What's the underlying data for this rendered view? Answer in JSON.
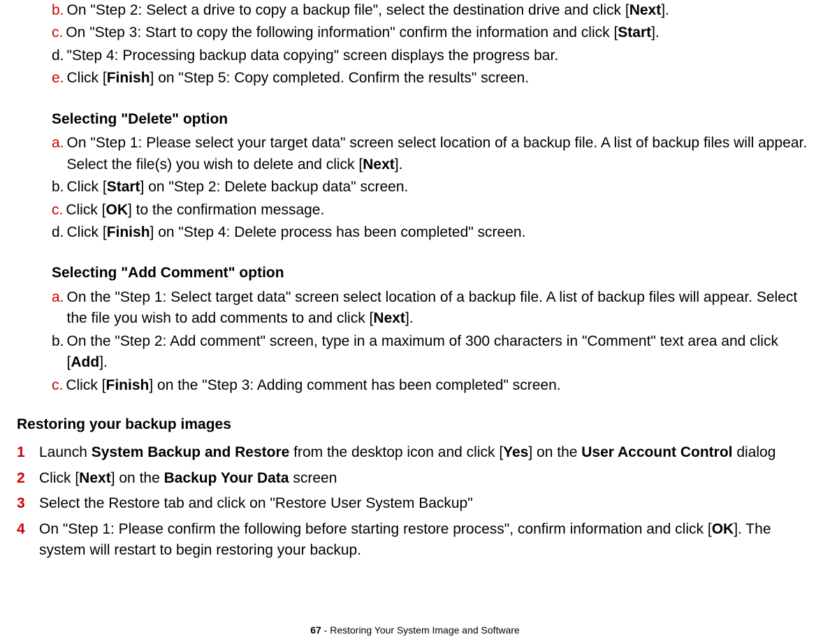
{
  "copy_section": {
    "b": {
      "part1": "On \"Step 2: Select a drive to copy a backup file\", select the destination drive and click  [",
      "btn": "Next",
      "part2": "]."
    },
    "c": {
      "part1": "On \"Step 3: Start to copy the following information\" confirm the information and click  [",
      "btn": "Start",
      "part2": "]."
    },
    "d": "\"Step 4: Processing backup data copying\" screen displays the progress bar.",
    "e": {
      "part1": "Click [",
      "btn": "Finish",
      "part2": "] on \"Step 5: Copy completed. Confirm the results\" screen."
    }
  },
  "delete_section": {
    "heading": "Selecting \"Delete\" option",
    "a": {
      "part1": "On \"Step 1: Please select your target data\" screen select location of a backup file.  A list of backup files will appear. Select the file(s) you wish to delete and click [",
      "btn": "Next",
      "part2": "]."
    },
    "b": {
      "part1": "Click [",
      "btn": "Start",
      "part2": "] on \"Step 2: Delete backup data\" screen."
    },
    "c": {
      "part1": "Click [",
      "btn": "OK",
      "part2": "] to the confirmation message."
    },
    "d": {
      "part1": "Click [",
      "btn": "Finish",
      "part2": "] on \"Step 4: Delete process has been completed\" screen."
    }
  },
  "addcomment_section": {
    "heading": "Selecting \"Add Comment\" option",
    "a": {
      "part1": "On the \"Step 1: Select target data\" screen select location of a backup file. A list of backup files will appear. Select the file you wish to add comments to and click [",
      "btn": "Next",
      "part2": "]."
    },
    "b": {
      "part1": "On the \"Step 2: Add comment\" screen, type in a maximum of 300 characters in \"Comment\" text area and click [",
      "btn": "Add",
      "part2": "]."
    },
    "c": {
      "part1": "Click [",
      "btn": "Finish",
      "part2": "] on the \"Step 3: Adding comment has been completed\" screen."
    }
  },
  "restore_section": {
    "heading": "Restoring your backup images",
    "items": {
      "1": {
        "p1": "Launch ",
        "b1": "System Backup and Restore",
        "p2": " from the desktop icon and click [",
        "btn": "Yes",
        "p3": "] on the ",
        "b2": "User Account Control",
        "p4": " dialog"
      },
      "2": {
        "p1": "Click [",
        "btn": "Next",
        "p2": "] on the ",
        "b1": "Backup Your Data",
        "p3": " screen"
      },
      "3": "Select the Restore tab and click on \"Restore User System Backup\"",
      "4": {
        "p1": "On \"Step 1: Please confirm the following before starting restore process\", confirm information and click [",
        "btn": "OK",
        "p2": "]. The system will restart to begin restoring your backup."
      }
    }
  },
  "footer": {
    "page": "67",
    "title": " - Restoring Your System Image and Software"
  },
  "letters": {
    "a": "a.",
    "b": "b.",
    "c": "c.",
    "d": "d.",
    "e": "e."
  },
  "nums": {
    "1": "1",
    "2": "2",
    "3": "3",
    "4": "4"
  }
}
